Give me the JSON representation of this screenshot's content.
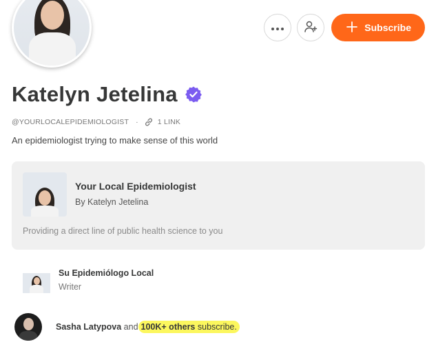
{
  "profile": {
    "name": "Katelyn Jetelina",
    "handle": "@YOURLOCALEPIDEMIOLOGIST",
    "separator": "·",
    "links": "1 LINK",
    "bio": "An epidemiologist trying to make sense of this world"
  },
  "actions": {
    "more_icon": "ellipsis-icon",
    "follow_icon": "add-user-icon",
    "subscribe_label": "Subscribe"
  },
  "publication": {
    "title": "Your Local Epidemiologist",
    "author": "By Katelyn Jetelina",
    "description": "Providing a direct line of public health science to you"
  },
  "writer_of": {
    "name": "Su Epidemiólogo Local",
    "role": "Writer"
  },
  "subscribers": {
    "name": "Sasha Latypova",
    "joiner": "and",
    "count": "100K+ others",
    "suffix": "subscribe."
  },
  "colors": {
    "accent": "#ff6719",
    "verified": "#7b5cf0",
    "highlight": "#fcf75e",
    "card_bg": "#f0f0f0"
  }
}
